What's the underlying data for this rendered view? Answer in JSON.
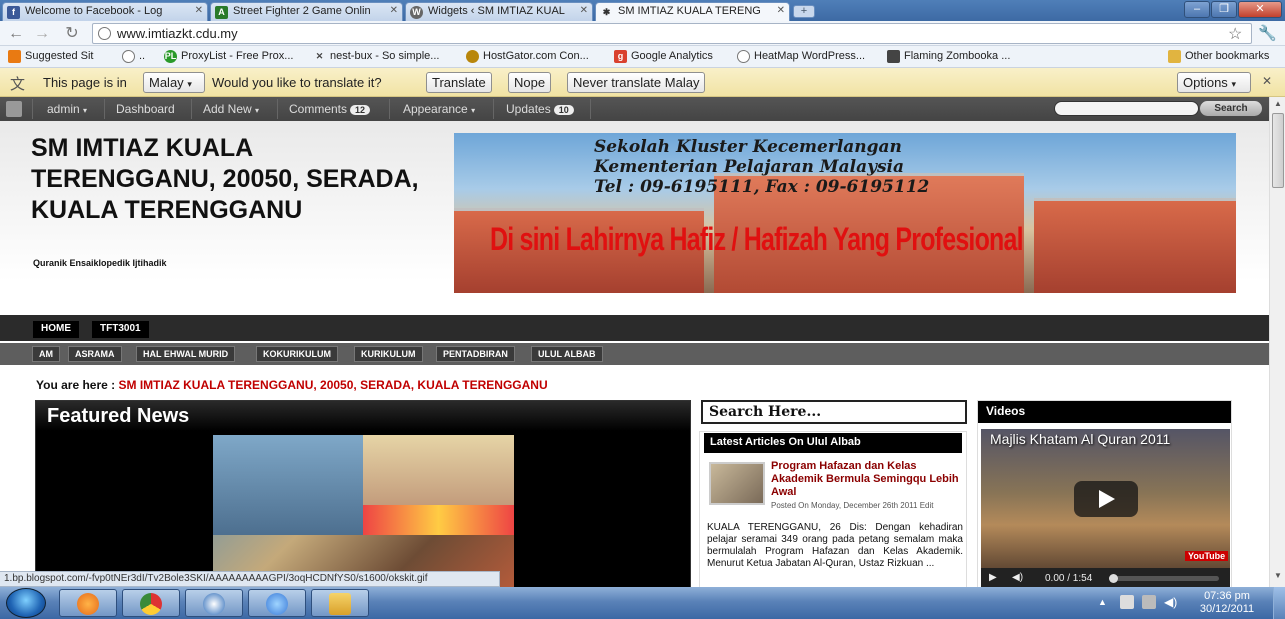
{
  "browser": {
    "tabs": [
      {
        "label": "Welcome to Facebook - Log",
        "icon": "facebook-icon",
        "color": "#3b5998"
      },
      {
        "label": "Street Fighter 2 Game Onlin",
        "icon": "game-icon",
        "color": "#2a7a2a"
      },
      {
        "label": "Widgets ‹ SM IMTIAZ KUAL",
        "icon": "wordpress-icon",
        "color": "#555555"
      },
      {
        "label": "SM IMTIAZ KUALA TERENG",
        "icon": "pin-icon",
        "color": "#333333"
      }
    ],
    "url": "www.imtiazkt.cdu.my",
    "bookmarks": [
      {
        "label": "Suggested Sit",
        "icon": "suggested-icon",
        "color": "#e97a12"
      },
      {
        "label": "..",
        "icon": "globe-icon",
        "color": "#777777"
      },
      {
        "label": "ProxyList - Free Prox...",
        "icon": "proxy-icon",
        "color": "#2a9a2a"
      },
      {
        "label": "nest-bux - So simple...",
        "icon": "x-icon",
        "color": "#444444"
      },
      {
        "label": "HostGator.com Con...",
        "icon": "hostgator-icon",
        "color": "#b8860b"
      },
      {
        "label": "Google Analytics",
        "icon": "analytics-icon",
        "color": "#d9412f"
      },
      {
        "label": "HeatMap WordPress...",
        "icon": "globe-icon",
        "color": "#777777"
      },
      {
        "label": "Flaming Zombooka ...",
        "icon": "game-icon",
        "color": "#444444"
      },
      {
        "label": "Other bookmarks",
        "icon": "folder-icon",
        "color": "#e1b440"
      }
    ],
    "translate": {
      "prefix": "This page is in",
      "language": "Malay",
      "question": "Would you like to translate it?",
      "translate_btn": "Translate",
      "nope_btn": "Nope",
      "never_btn": "Never translate Malay",
      "options_btn": "Options"
    },
    "status_url": "1.bp.blogspot.com/-fvp0tNEr3dI/Tv2Bole3SKI/AAAAAAAAAGPI/3oqHCDNfYS0/s1600/okskit.gif"
  },
  "adminbar": {
    "items": [
      "admin",
      "Dashboard",
      "Add New",
      "Comments",
      "Appearance",
      "Updates"
    ],
    "comments_count": "12",
    "updates_count": "10",
    "search_label": "Search"
  },
  "site": {
    "title": "SM IMTIAZ KUALA TERENGGANU, 20050, SERADA, KUALA TERENGGANU",
    "tagline": "Quranik Ensaiklopedik Ijtihadik",
    "banner_line1": "Sekolah Kluster Kecemerlangan",
    "banner_line2": "Kementerian Pelajaran Malaysia",
    "banner_line3": "Tel : 09-6195111, Fax : 09-6195112",
    "banner_slogan": "Di sini Lahirnya Hafiz / Hafizah Yang Profesional",
    "menu_primary": [
      "HOME",
      "TFT3001"
    ],
    "menu_secondary": [
      "AM",
      "ASRAMA",
      "HAL EHWAL MURID",
      "KOKURIKULUM",
      "KURIKULUM",
      "PENTADBIRAN",
      "ULUL ALBAB"
    ],
    "crumb_prefix": "You are here :",
    "crumb_current": "SM IMTIAZ KUALA TERENGGANU, 20050, SERADA, KUALA TERENGGANU"
  },
  "featured": {
    "heading": "Featured News"
  },
  "sidebar": {
    "search_placeholder": "Search Here...",
    "latest_heading": "Latest Articles On Ulul Albab",
    "article_title": "Program Hafazan dan Kelas Akademik Bermula Semingqu Lebih Awal",
    "article_meta": "Posted On Monday, December 26th 2011",
    "article_edit": "Edit",
    "article_body": "KUALA TERENGGANU, 26 Dis: Dengan kehadiran pelajar seramai 349 orang pada petang semalam maka bermulalah Program Hafazan dan Kelas Akademik. Menurut Ketua Jabatan Al-Quran, Ustaz Rizkuan ..."
  },
  "videos": {
    "heading": "Videos",
    "title": "Majlis Khatam Al Quran 2011",
    "time": "0.00 / 1:54",
    "brand": "YouTube"
  },
  "taskbar": {
    "apps": [
      {
        "name": "firefox-icon",
        "color": "#e66a1a"
      },
      {
        "name": "chrome-icon",
        "color": "#3a8a3a"
      },
      {
        "name": "paint-icon",
        "color": "#2a6ab8"
      },
      {
        "name": "ie-icon",
        "color": "#3a7ad8"
      },
      {
        "name": "explorer-icon",
        "color": "#d9a02a"
      }
    ],
    "time": "07:36 pm",
    "date": "30/12/2011"
  }
}
